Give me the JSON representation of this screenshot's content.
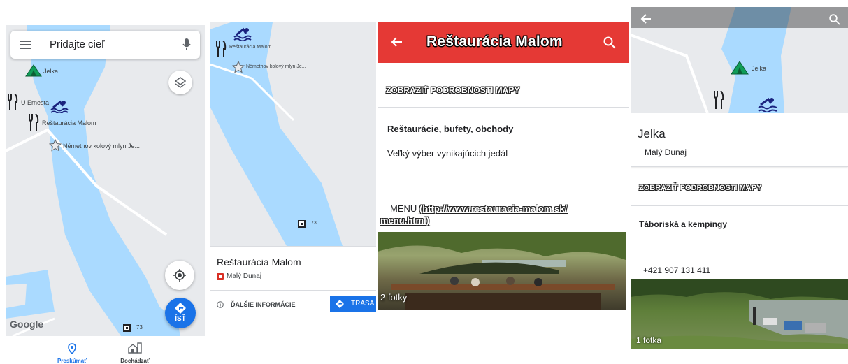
{
  "panel1": {
    "search_placeholder": "Pridajte cieľ",
    "labels": {
      "jelka": "Jelka",
      "u_ernesta": "U Ernesta",
      "restauracia": "Reštaurácia Malom",
      "nemethov": "Némethov kolový mlyn Je..."
    },
    "route_number": "73",
    "google_logo": "Google",
    "go_label": "ÍSŤ",
    "bottom_nav": [
      {
        "label": "Preskúmať"
      },
      {
        "label": "Dochádzať"
      }
    ]
  },
  "panel2": {
    "labels": {
      "restauracia": "Reštaurácia Malom",
      "nemethov": "Némethov kolový mlyn Je..."
    },
    "route_number": "73",
    "place_title": "Reštaurácia Malom",
    "place_subtitle": "Malý Dunaj",
    "more_info": "ĎALŠIE INFORMÁCIE",
    "route_button": "TRASA"
  },
  "panel3": {
    "header_title": "Reštaurácia Malom",
    "map_details_link": "ZOBRAZIŤ PODROBNOSTI MAPY",
    "category": "Reštaurácie, bufety, obchody",
    "description": "Veľký výber vynikajúcich jedál",
    "menu_prefix": "MENU",
    "menu_link_1": "(http://www.restauracia-malom.sk/",
    "menu_link_2": "menu.html)",
    "photo_count": "2 fotky"
  },
  "panel4": {
    "map_label": "Jelka",
    "place_title": "Jelka",
    "place_subtitle": "Malý Dunaj",
    "map_details_link": "ZOBRAZIŤ PODROBNOSTI MAPY",
    "category": "Táboriská a kempingy",
    "phone": "+421 907 131 411",
    "photo_count": "1 fotka"
  },
  "colors": {
    "water": "#aadaff",
    "land": "#e8eaed",
    "header_red": "#e53935",
    "accent_blue": "#1a73e8",
    "camp_green": "#0f9d58"
  }
}
